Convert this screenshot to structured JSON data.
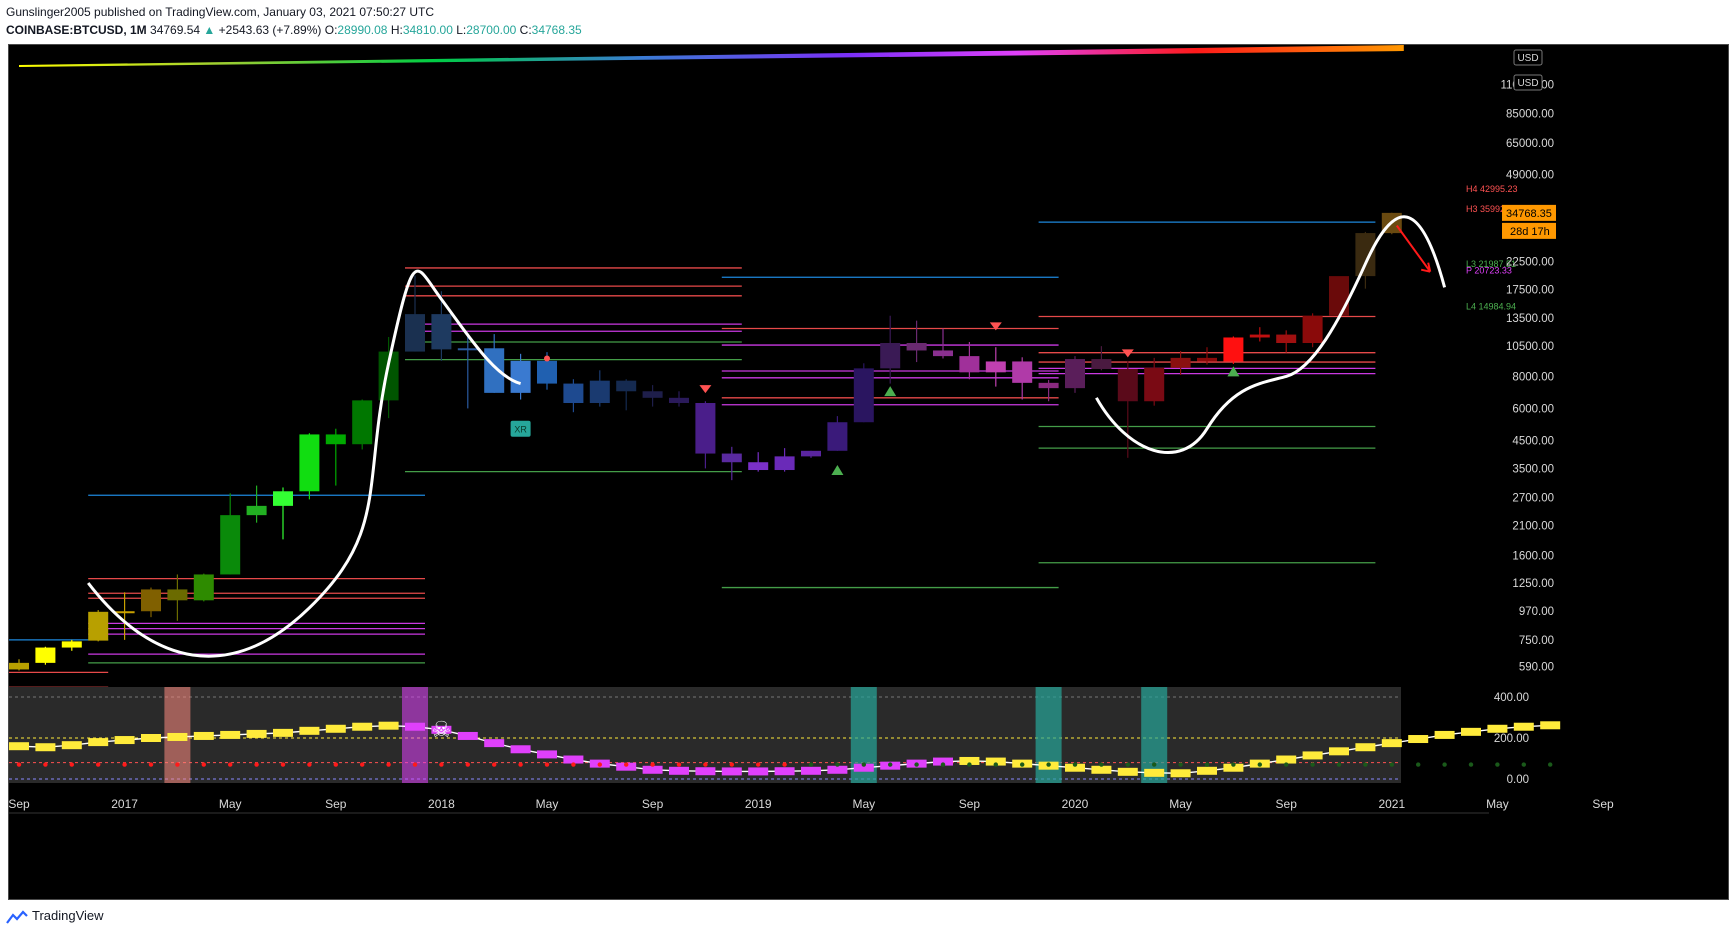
{
  "header": {
    "publisher_line": "Gunslinger2005 published on TradingView.com, January 03, 2021 07:50:27 UTC",
    "symbol": "COINBASE:BTCUSD, 1M",
    "last": "34769.54",
    "change": "+2543.63 (+7.89%)",
    "open_label": "O:",
    "open": "28990.08",
    "high_label": "H:",
    "high": "34810.00",
    "low_label": "L:",
    "low": "28700.00",
    "close_label": "C:",
    "close": "34768.35"
  },
  "price_axis": {
    "currency_label": "USD",
    "ticks": [
      "110000.00",
      "85000.00",
      "65000.00",
      "49000.00",
      "34768.35",
      "22500.00",
      "17500.00",
      "13500.00",
      "10500.00",
      "8000.00",
      "6000.00",
      "4500.00",
      "3500.00",
      "2700.00",
      "2100.00",
      "1600.00",
      "1250.00",
      "970.00",
      "750.00",
      "590.00"
    ],
    "current_price": "34768.35",
    "countdown": "28d 17h"
  },
  "osc_axis": {
    "ticks": [
      "400.00",
      "200.00",
      "0.00"
    ]
  },
  "time_axis": {
    "ticks": [
      "Sep",
      "2017",
      "May",
      "Sep",
      "2018",
      "May",
      "Sep",
      "2019",
      "May",
      "Sep",
      "2020",
      "May",
      "Sep",
      "2021",
      "May",
      "Sep"
    ]
  },
  "pivot_labels": {
    "h4": "H4 42995.23",
    "h3": "H3 35992.65",
    "l3": "L3 21987.51",
    "p": "P 20723.33",
    "l4": "L4 14984.94"
  },
  "badge_label": "XR",
  "footer": {
    "brand": "TradingView"
  },
  "colors": {
    "background": "#000000",
    "up": "#26a69a",
    "accent_orange": "#ff9800",
    "pivot_red": "#ff5252",
    "pivot_magenta": "#e040fb",
    "pivot_green": "#4caf50",
    "pivot_blue": "#2196f3"
  },
  "chart_data": {
    "type": "candlestick",
    "title": "COINBASE:BTCUSD, 1M",
    "y_scale": "log",
    "ylim": [
      500,
      120000
    ],
    "x_range": [
      "2016-09",
      "2022-09"
    ],
    "candles": [
      {
        "t": "2016-09",
        "o": 575,
        "h": 630,
        "l": 570,
        "c": 610,
        "color": "#b8a000"
      },
      {
        "t": "2016-10",
        "o": 610,
        "h": 705,
        "l": 600,
        "c": 700,
        "color": "#ffff00"
      },
      {
        "t": "2016-11",
        "o": 700,
        "h": 750,
        "l": 680,
        "c": 740,
        "color": "#ffff00"
      },
      {
        "t": "2016-12",
        "o": 745,
        "h": 980,
        "l": 740,
        "c": 965,
        "color": "#b8a000"
      },
      {
        "t": "2017-01",
        "o": 965,
        "h": 1150,
        "l": 750,
        "c": 970,
        "color": "#c8a000"
      },
      {
        "t": "2017-02",
        "o": 970,
        "h": 1200,
        "l": 920,
        "c": 1180,
        "color": "#806000"
      },
      {
        "t": "2017-03",
        "o": 1180,
        "h": 1350,
        "l": 890,
        "c": 1070,
        "color": "#6b6b00"
      },
      {
        "t": "2017-04",
        "o": 1070,
        "h": 1360,
        "l": 1060,
        "c": 1350,
        "color": "#2e8b00"
      },
      {
        "t": "2017-05",
        "o": 1350,
        "h": 2800,
        "l": 1350,
        "c": 2300,
        "color": "#0a8a0a"
      },
      {
        "t": "2017-06",
        "o": 2300,
        "h": 3000,
        "l": 2150,
        "c": 2500,
        "color": "#22b022"
      },
      {
        "t": "2017-07",
        "o": 2500,
        "h": 2950,
        "l": 1850,
        "c": 2850,
        "color": "#33ff33"
      },
      {
        "t": "2017-08",
        "o": 2850,
        "h": 4800,
        "l": 2650,
        "c": 4750,
        "color": "#11dd11"
      },
      {
        "t": "2017-09",
        "o": 4750,
        "h": 5000,
        "l": 3000,
        "c": 4350,
        "color": "#00aa00"
      },
      {
        "t": "2017-10",
        "o": 4350,
        "h": 6500,
        "l": 4150,
        "c": 6450,
        "color": "#007700"
      },
      {
        "t": "2017-11",
        "o": 6450,
        "h": 11400,
        "l": 5500,
        "c": 10000,
        "color": "#005500"
      },
      {
        "t": "2017-12",
        "o": 10000,
        "h": 19800,
        "l": 10000,
        "c": 14000,
        "color": "#1a3050"
      },
      {
        "t": "2018-01",
        "o": 14000,
        "h": 17200,
        "l": 9200,
        "c": 10200,
        "color": "#1e3a60"
      },
      {
        "t": "2018-02",
        "o": 10200,
        "h": 11800,
        "l": 6000,
        "c": 10300,
        "color": "#2a5aa0"
      },
      {
        "t": "2018-03",
        "o": 10300,
        "h": 11700,
        "l": 6900,
        "c": 6900,
        "color": "#3070c0"
      },
      {
        "t": "2018-04",
        "o": 6900,
        "h": 9800,
        "l": 6500,
        "c": 9200,
        "color": "#3a7ad0"
      },
      {
        "t": "2018-05",
        "o": 9200,
        "h": 9950,
        "l": 7100,
        "c": 7500,
        "color": "#2060b0"
      },
      {
        "t": "2018-06",
        "o": 7500,
        "h": 7800,
        "l": 5800,
        "c": 6300,
        "color": "#1e4a90"
      },
      {
        "t": "2018-07",
        "o": 6300,
        "h": 8450,
        "l": 6100,
        "c": 7700,
        "color": "#1a3a70"
      },
      {
        "t": "2018-08",
        "o": 7700,
        "h": 7800,
        "l": 5900,
        "c": 7000,
        "color": "#152a50"
      },
      {
        "t": "2018-09",
        "o": 7000,
        "h": 7400,
        "l": 6100,
        "c": 6600,
        "color": "#1e1e4a"
      },
      {
        "t": "2018-10",
        "o": 6600,
        "h": 7000,
        "l": 6100,
        "c": 6300,
        "color": "#2a1a5a"
      },
      {
        "t": "2018-11",
        "o": 6300,
        "h": 6400,
        "l": 3500,
        "c": 4000,
        "color": "#4a1e8a"
      },
      {
        "t": "2018-12",
        "o": 4000,
        "h": 4250,
        "l": 3150,
        "c": 3700,
        "color": "#5a2aa0"
      },
      {
        "t": "2019-01",
        "o": 3700,
        "h": 4050,
        "l": 3400,
        "c": 3450,
        "color": "#7a30c8"
      },
      {
        "t": "2019-02",
        "o": 3450,
        "h": 4200,
        "l": 3400,
        "c": 3900,
        "color": "#6a2ab8"
      },
      {
        "t": "2019-03",
        "o": 3900,
        "h": 4100,
        "l": 3850,
        "c": 4100,
        "color": "#5a25a0"
      },
      {
        "t": "2019-04",
        "o": 4100,
        "h": 5600,
        "l": 4100,
        "c": 5300,
        "color": "#3a1a7a"
      },
      {
        "t": "2019-05",
        "o": 5300,
        "h": 9000,
        "l": 5300,
        "c": 8600,
        "color": "#2a1560"
      },
      {
        "t": "2019-06",
        "o": 8600,
        "h": 13800,
        "l": 7500,
        "c": 10800,
        "color": "#3a1a55"
      },
      {
        "t": "2019-07",
        "o": 10800,
        "h": 13200,
        "l": 9100,
        "c": 10100,
        "color": "#6a2a70"
      },
      {
        "t": "2019-08",
        "o": 10100,
        "h": 12300,
        "l": 9400,
        "c": 9600,
        "color": "#8a3090"
      },
      {
        "t": "2019-09",
        "o": 9600,
        "h": 10900,
        "l": 7800,
        "c": 8300,
        "color": "#a0309a"
      },
      {
        "t": "2019-10",
        "o": 8300,
        "h": 10400,
        "l": 7300,
        "c": 9150,
        "color": "#c040b0"
      },
      {
        "t": "2019-11",
        "o": 9150,
        "h": 9500,
        "l": 6500,
        "c": 7550,
        "color": "#b03aa8"
      },
      {
        "t": "2019-12",
        "o": 7550,
        "h": 7750,
        "l": 6400,
        "c": 7200,
        "color": "#8a2a80"
      },
      {
        "t": "2020-01",
        "o": 7200,
        "h": 9600,
        "l": 6900,
        "c": 9350,
        "color": "#5a1e5a"
      },
      {
        "t": "2020-02",
        "o": 9350,
        "h": 10500,
        "l": 8450,
        "c": 8550,
        "color": "#4a1a40"
      },
      {
        "t": "2020-03",
        "o": 8550,
        "h": 9200,
        "l": 3850,
        "c": 6400,
        "color": "#5a0a1a"
      },
      {
        "t": "2020-04",
        "o": 6400,
        "h": 9450,
        "l": 6150,
        "c": 8650,
        "color": "#7a0a14"
      },
      {
        "t": "2020-05",
        "o": 8650,
        "h": 10050,
        "l": 8100,
        "c": 9450,
        "color": "#8a1010"
      },
      {
        "t": "2020-06",
        "o": 9450,
        "h": 10400,
        "l": 8900,
        "c": 9150,
        "color": "#8a0a0a"
      },
      {
        "t": "2020-07",
        "o": 9150,
        "h": 11450,
        "l": 8950,
        "c": 11350,
        "color": "#ff1010"
      },
      {
        "t": "2020-08",
        "o": 11350,
        "h": 12450,
        "l": 10950,
        "c": 11650,
        "color": "#c01010"
      },
      {
        "t": "2020-09",
        "o": 11650,
        "h": 12100,
        "l": 9900,
        "c": 10800,
        "color": "#a01010"
      },
      {
        "t": "2020-10",
        "o": 10800,
        "h": 14100,
        "l": 10400,
        "c": 13800,
        "color": "#8a0a0a"
      },
      {
        "t": "2020-11",
        "o": 13800,
        "h": 19500,
        "l": 13250,
        "c": 19700,
        "color": "#6a0a0a"
      },
      {
        "t": "2020-12",
        "o": 19700,
        "h": 29300,
        "l": 17600,
        "c": 29000,
        "color": "#3a2a10"
      },
      {
        "t": "2021-01",
        "o": 28990.08,
        "h": 34810,
        "l": 28700,
        "c": 34768.35,
        "color": "#6a4a10"
      }
    ],
    "pivot_levels": [
      {
        "name": "H4",
        "value": 42995.23
      },
      {
        "name": "H3",
        "value": 35992.65
      },
      {
        "name": "L3",
        "value": 21987.51
      },
      {
        "name": "P",
        "value": 20723.33
      },
      {
        "name": "L4",
        "value": 14984.94
      }
    ],
    "oscillator": {
      "ylim": [
        0,
        400
      ],
      "ticks": [
        0,
        200,
        400
      ],
      "values": [
        160,
        155,
        165,
        180,
        190,
        200,
        205,
        210,
        215,
        220,
        225,
        235,
        245,
        255,
        260,
        255,
        240,
        210,
        175,
        145,
        120,
        95,
        75,
        60,
        45,
        40,
        38,
        37,
        37,
        38,
        40,
        45,
        55,
        65,
        75,
        85,
        88,
        85,
        75,
        65,
        55,
        45,
        35,
        30,
        28,
        40,
        55,
        75,
        95,
        115,
        135,
        155,
        175,
        195,
        215,
        230,
        245,
        255,
        262
      ]
    }
  }
}
